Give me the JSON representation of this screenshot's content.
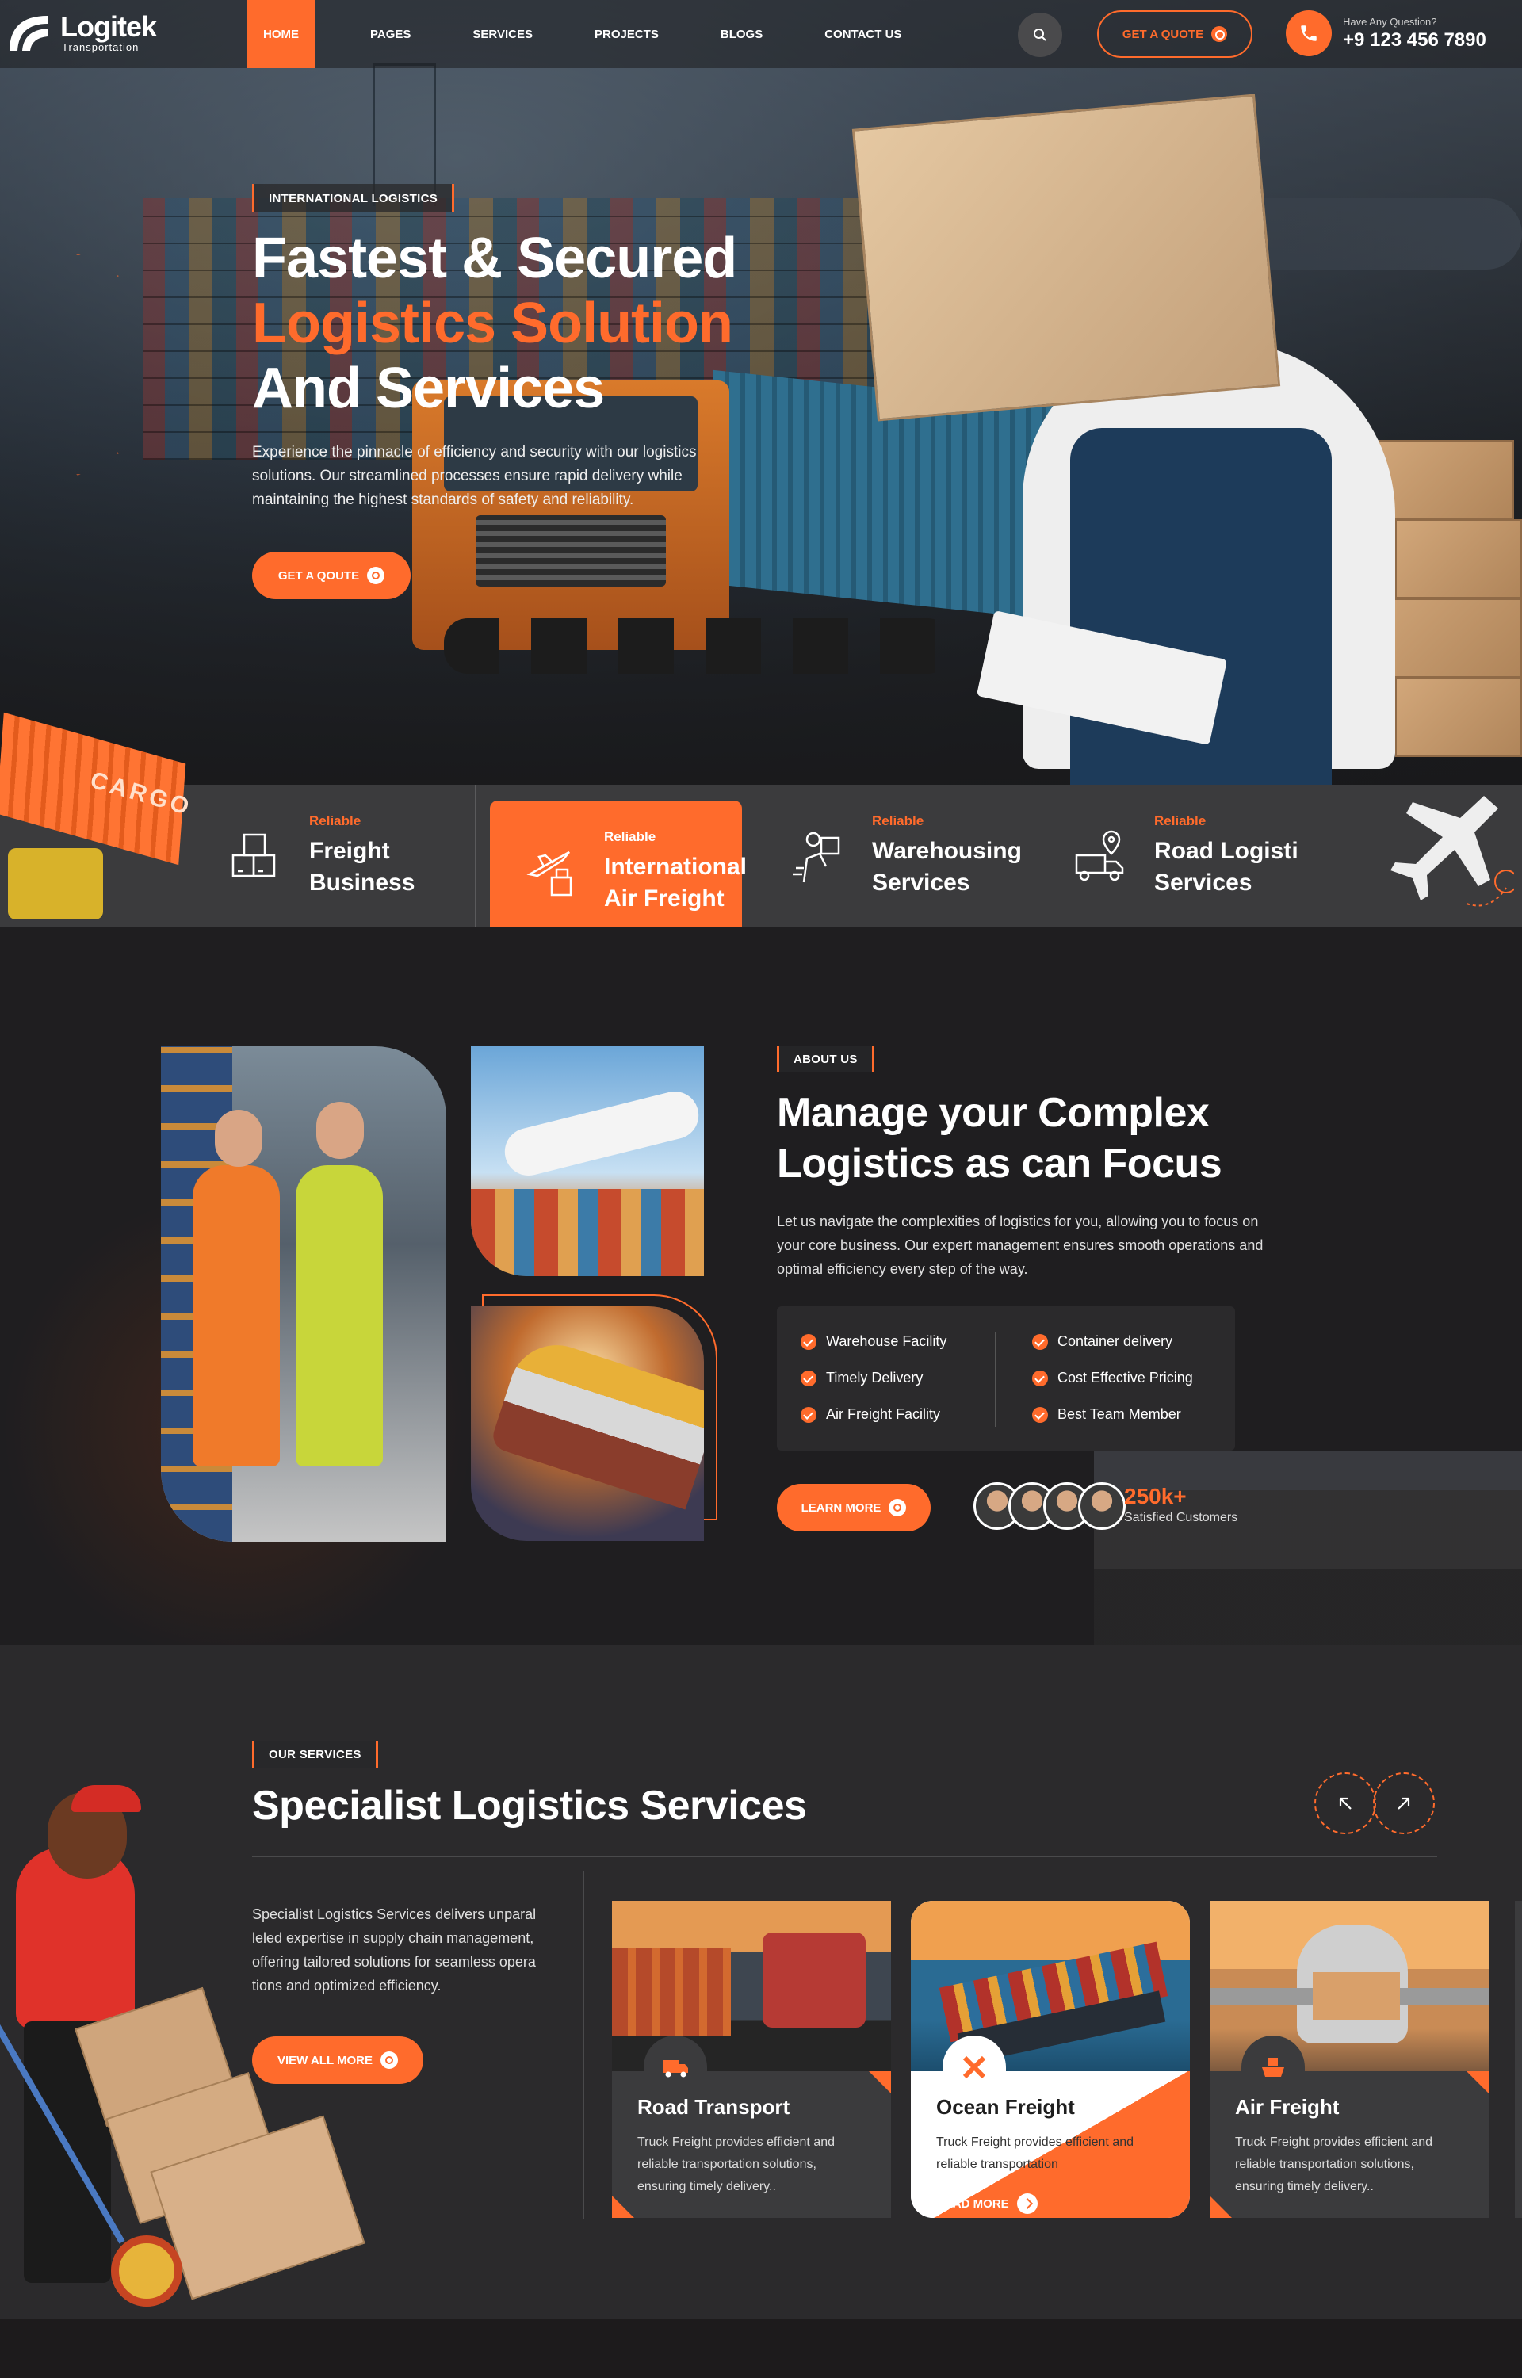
{
  "brand": {
    "name": "Logitek",
    "tagline": "Transportation"
  },
  "colors": {
    "accent": "#ff6b2c",
    "dark": "#1f1e20",
    "panel": "#3b3b3d"
  },
  "nav": {
    "items": [
      {
        "label": "HOME",
        "active": true
      },
      {
        "label": "PAGES",
        "active": false
      },
      {
        "label": "SERVICES",
        "active": false
      },
      {
        "label": "PROJECTS",
        "active": false
      },
      {
        "label": "BLOGS",
        "active": false
      },
      {
        "label": "CONTACT US",
        "active": false
      }
    ],
    "search_icon": "search-icon",
    "quote_label": "GET A QUOTE",
    "phone_question": "Have Any Question?",
    "phone_number": "+9 123 456 7890"
  },
  "hero": {
    "tag": "INTERNATIONAL LOGISTICS",
    "title_line1": "Fastest & Secured",
    "title_line2": "Logistics Solution",
    "title_line3": "And Services",
    "description": "Experience the pinnacle of efficiency and security with our logistics solutions. Our streamlined processes ensure rapid delivery while maintaining the highest standards of safety and reliability.",
    "cta_label": "GET A QOUTE"
  },
  "features": [
    {
      "kicker": "Reliable",
      "title": "Freight Business",
      "icon": "boxes-icon",
      "active": false
    },
    {
      "kicker": "Reliable",
      "title": "International Air Freight",
      "icon": "plane-boxes-icon",
      "active": true
    },
    {
      "kicker": "Reliable",
      "title": "Warehousing Services",
      "icon": "courier-icon",
      "active": false
    },
    {
      "kicker": "Reliable",
      "title": "Road Logisti Services",
      "icon": "truck-pin-icon",
      "active": false
    }
  ],
  "feature_titles": {
    "f1a": "Freight",
    "f1b": "Business",
    "f2a": "International",
    "f2b": "Air Freight",
    "f3a": "Warehousing",
    "f3b": "Services",
    "f4a": "Road Logisti",
    "f4b": "Services"
  },
  "cargo_text": "CARGO",
  "about": {
    "tag": "ABOUT US",
    "title_line1": "Manage your Complex",
    "title_line2": "Logistics as can Focus",
    "description": "Let us navigate the complexities of logistics for you, allowing you to focus on your core business. Our expert management ensures smooth operations and optimal efficiency every step of the way.",
    "checks_left": [
      "Warehouse Facility",
      "Timely Delivery",
      "Air Freight Facility"
    ],
    "checks_right": [
      "Container delivery",
      "Cost Effective Pricing",
      "Best Team Member"
    ],
    "cta_label": "LEARN MORE",
    "customers_count": "250k+",
    "customers_label": "Satisfied Customers"
  },
  "services": {
    "tag": "OUR SERVICES",
    "title": "Specialist Logistics Services",
    "description": "Specialist Logistics Services delivers unparal leled expertise in supply chain management, offering tailored solutions for seamless opera tions and optimized efficiency.",
    "cta_label": "VIEW ALL MORE",
    "cards": [
      {
        "title": "Road Transport",
        "desc": "Truck Freight provides efficient and reliable transportation solutions, ensuring timely delivery..",
        "icon": "truck-icon",
        "active": false
      },
      {
        "title": "Ocean Freight",
        "desc": "Truck Freight provides efficient and reliable transportation",
        "icon": "ship-icon",
        "active": true,
        "link": "READ MORE"
      },
      {
        "title": "Air Freight",
        "desc": "Truck Freight provides efficient and reliable transportation solutions, ensuring timely delivery..",
        "icon": "cargo-ship-icon",
        "active": false
      }
    ]
  }
}
